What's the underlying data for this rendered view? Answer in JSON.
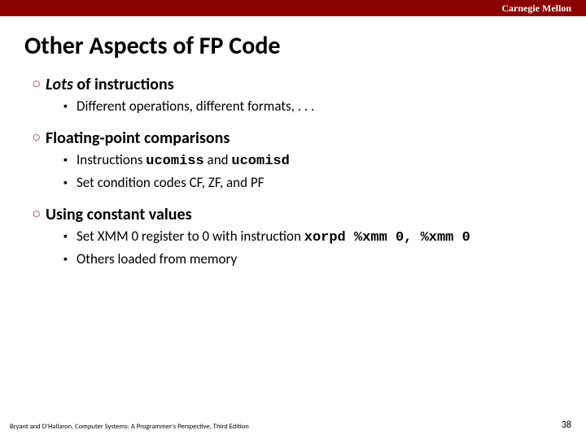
{
  "header": {
    "brand": "Carnegie Mellon"
  },
  "title": "Other Aspects of FP Code",
  "bullets": [
    {
      "label_pre": "Lots",
      "label_post": " of instructions",
      "sub": [
        {
          "parts": [
            {
              "t": "Different operations, different formats, . . .",
              "mono": false
            }
          ]
        }
      ]
    },
    {
      "label_pre": "",
      "label_post": "Floating-point comparisons",
      "sub": [
        {
          "parts": [
            {
              "t": "Instructions ",
              "mono": false
            },
            {
              "t": "ucomiss",
              "mono": true
            },
            {
              "t": " and ",
              "mono": false
            },
            {
              "t": "ucomisd",
              "mono": true
            }
          ]
        },
        {
          "parts": [
            {
              "t": "Set condition codes CF, ZF, and PF",
              "mono": false
            }
          ]
        }
      ]
    },
    {
      "label_pre": "",
      "label_post": "Using constant values",
      "sub": [
        {
          "parts": [
            {
              "t": "Set XMM 0 register to 0 with instruction ",
              "mono": false
            },
            {
              "t": "xorpd %xmm 0, %xmm 0",
              "mono": true
            }
          ]
        },
        {
          "parts": [
            {
              "t": "Others loaded from memory",
              "mono": false
            }
          ]
        }
      ]
    }
  ],
  "footer": {
    "left": "Bryant and O'Hallaron, Computer Systems: A Programmer's Perspective, Third Edition",
    "right": "38"
  }
}
